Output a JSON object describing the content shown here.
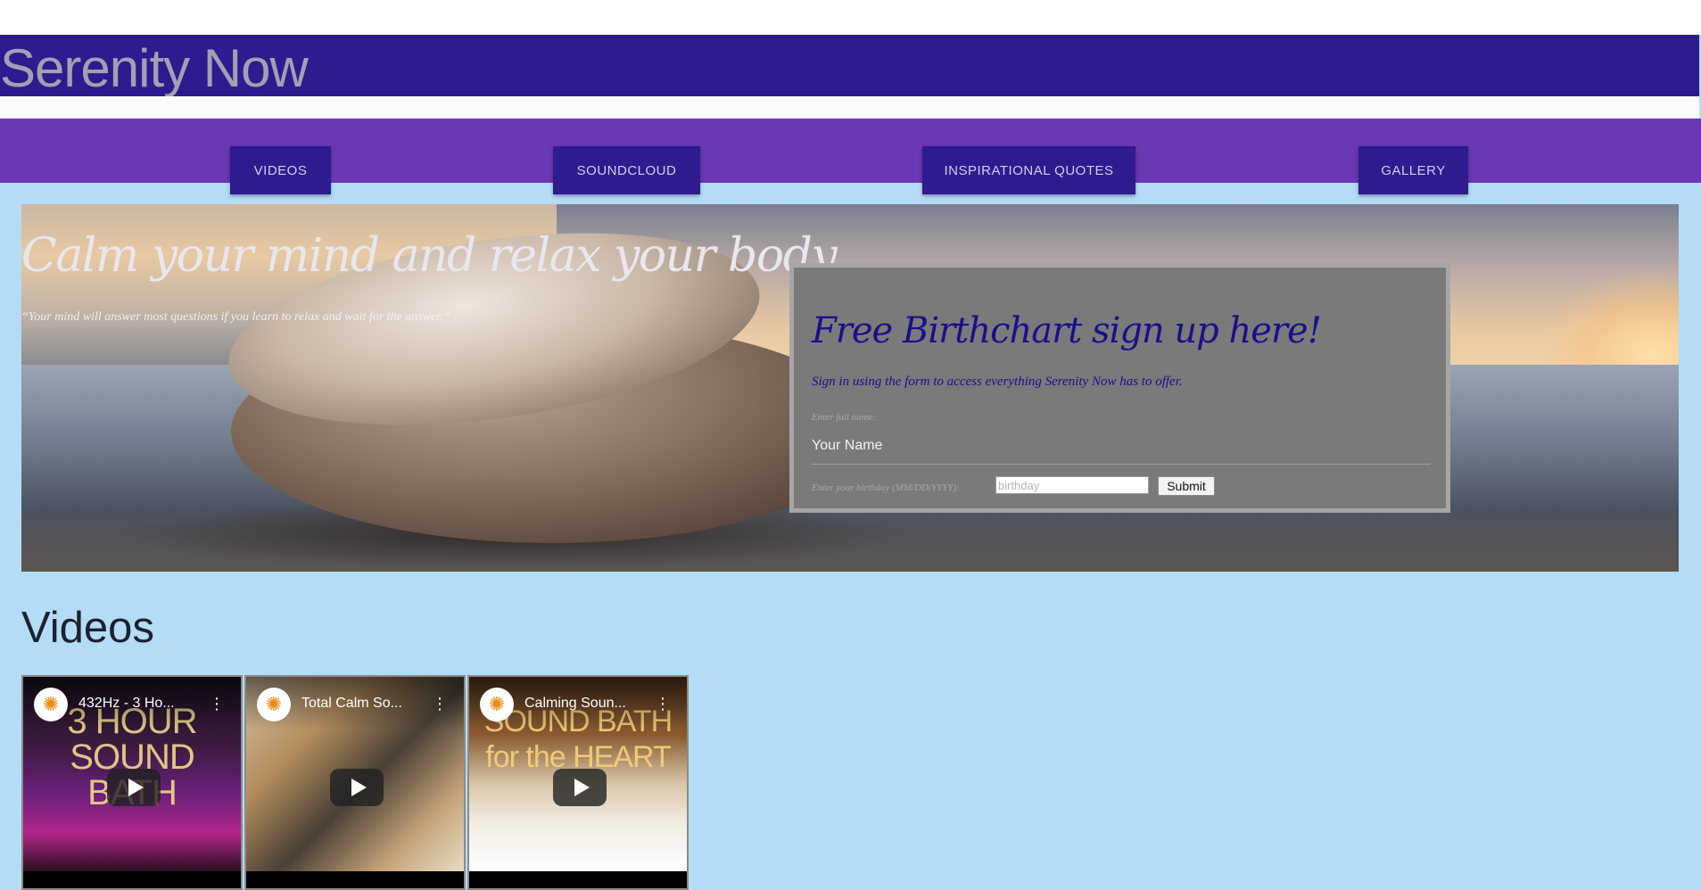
{
  "header": {
    "site_title": "Serenity Now"
  },
  "nav": {
    "items": [
      {
        "label": "VIDEOS"
      },
      {
        "label": "SOUNDCLOUD"
      },
      {
        "label": "INSPIRATIONAL QUOTES"
      },
      {
        "label": "GALLERY"
      }
    ]
  },
  "hero": {
    "headline": "Calm your mind and relax your body.",
    "quote": "“Your mind will answer most questions if you learn to relax and wait for the answer.”"
  },
  "signup": {
    "title": "Free Birthchart sign up here!",
    "subtitle": "Sign in using the form to access everything Serenity Now has to offer.",
    "name_label": "Enter full name:",
    "name_placeholder": "Your Name",
    "birthday_label": "Enter your birthday (MM/DD/YYYY):",
    "birthday_placeholder": "birthday",
    "submit_label": "Submit"
  },
  "videos": {
    "heading": "Videos",
    "items": [
      {
        "title": "432Hz - 3 Ho...",
        "thumb_text": "3 HOUR SOUND BATH"
      },
      {
        "title": "Total Calm So...",
        "thumb_text": ""
      },
      {
        "title": "Calming Soun...",
        "thumb_text": "SOUND BATH for the HEART"
      }
    ]
  },
  "colors": {
    "title_bar": "#2d1b8f",
    "nav_bar": "#6b38b4",
    "page_background": "#b5dcf6"
  }
}
